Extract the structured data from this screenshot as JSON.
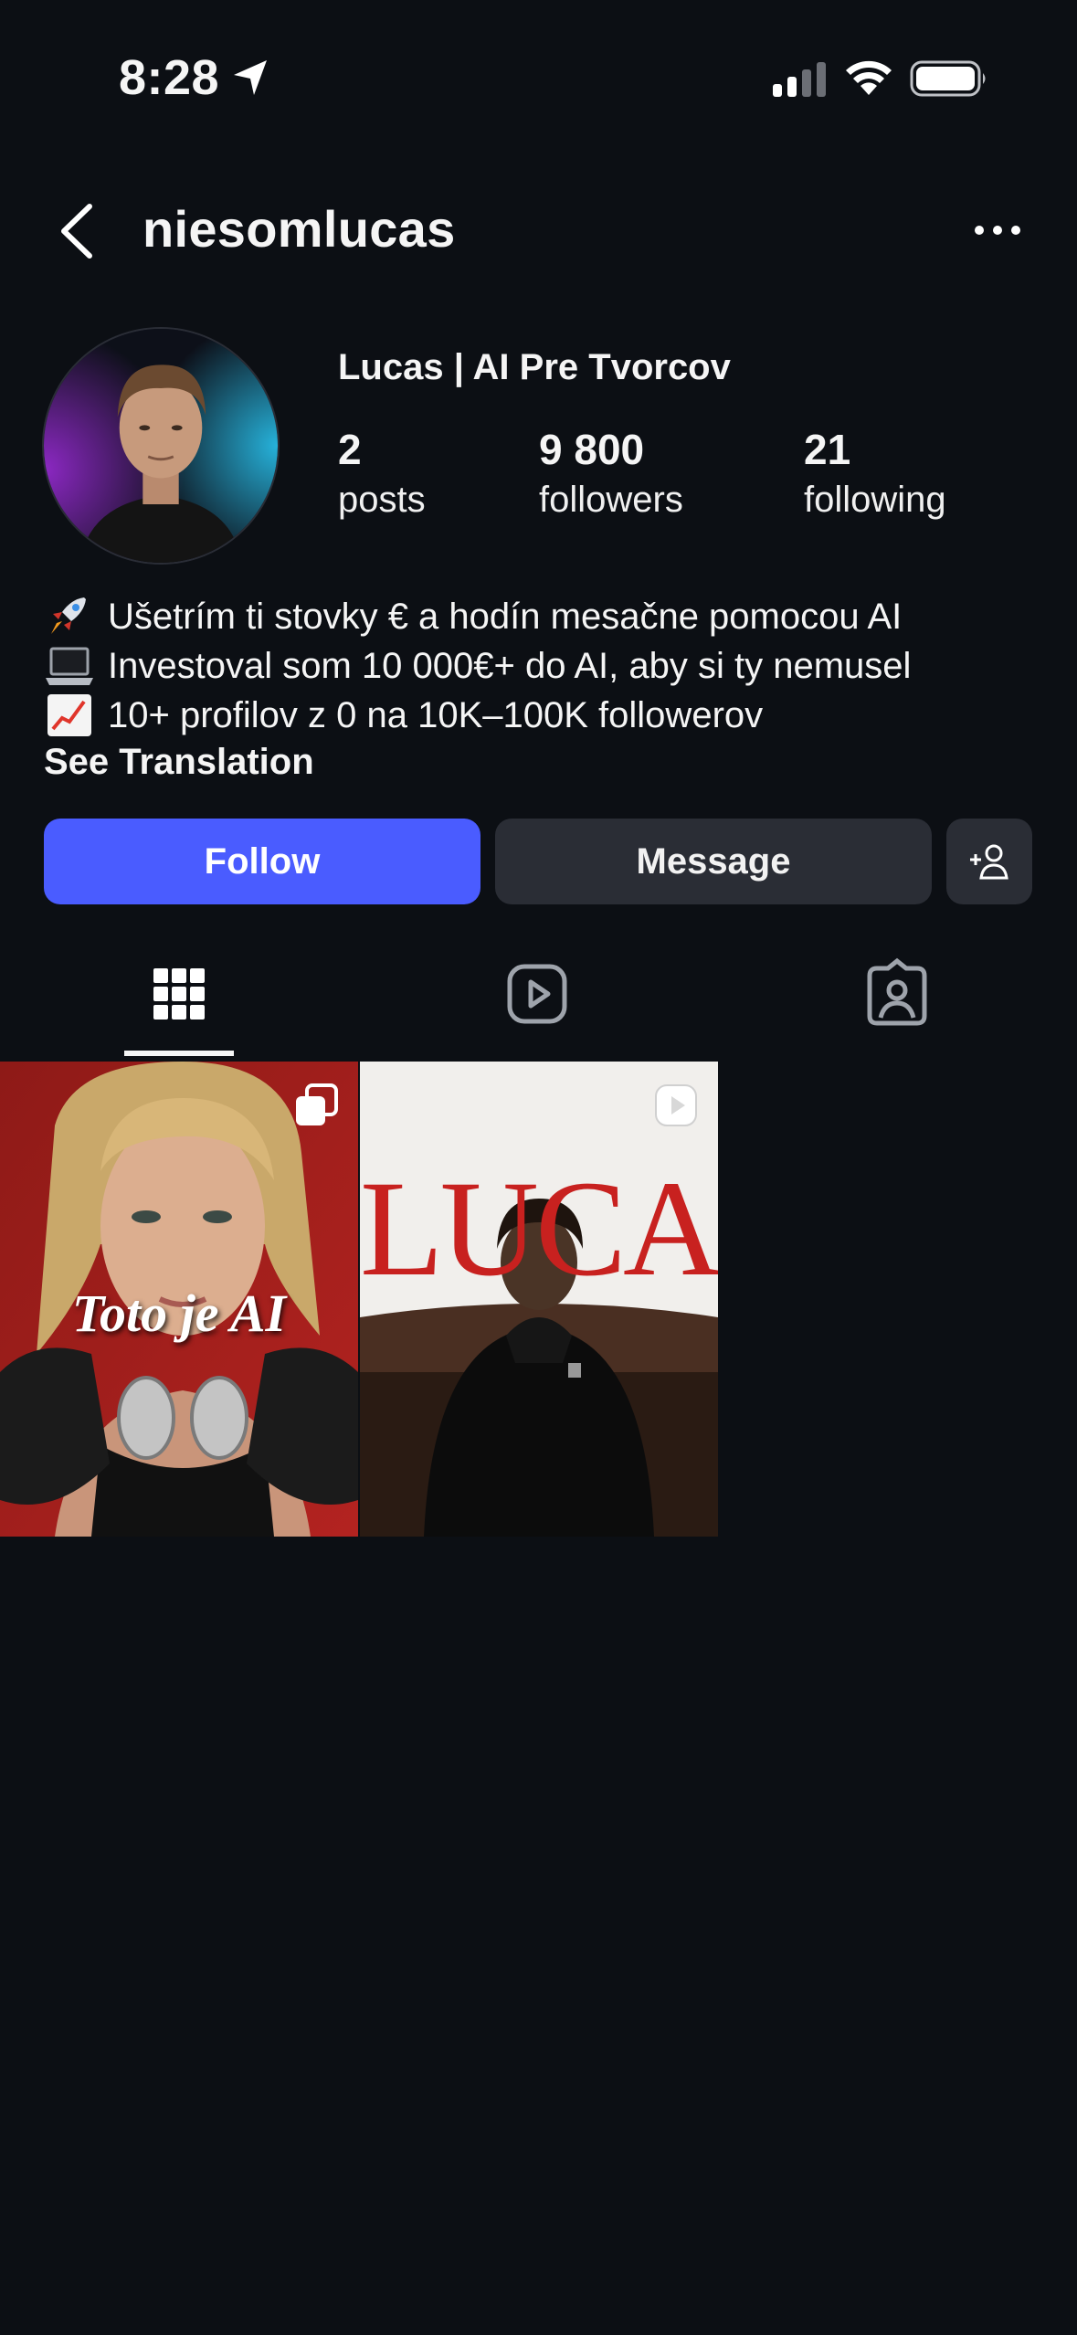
{
  "status_bar": {
    "time": "8:28",
    "icons": [
      "location-arrow-icon",
      "cellular-signal-icon",
      "wifi-icon",
      "battery-icon"
    ]
  },
  "header": {
    "username": "niesomlucas",
    "back_icon": "chevron-left-icon",
    "more_icon": "more-horizontal-icon"
  },
  "profile": {
    "display_name": "Lucas | AI Pre Tvorcov",
    "stats": {
      "posts": {
        "value": "2",
        "label": "posts"
      },
      "followers": {
        "value": "9 800",
        "label": "followers"
      },
      "following": {
        "value": "21",
        "label": "following"
      }
    },
    "bio": [
      {
        "emoji": "rocket-icon",
        "text": "Ušetrím ti stovky € a hodín mesačne pomocou AI"
      },
      {
        "emoji": "laptop-icon",
        "text": "Investoval som 10 000€+ do AI, aby si ty nemusel"
      },
      {
        "emoji": "chart-increasing-icon",
        "text": "10+ profilov z 0 na 10K–100K followerov"
      }
    ],
    "see_translation": "See Translation"
  },
  "actions": {
    "follow_label": "Follow",
    "message_label": "Message",
    "add_person_icon": "add-person-icon"
  },
  "tabs": [
    {
      "name": "grid",
      "icon": "grid-icon",
      "active": true
    },
    {
      "name": "reels",
      "icon": "reels-icon",
      "active": false
    },
    {
      "name": "tagged",
      "icon": "tagged-icon",
      "active": false
    }
  ],
  "posts": [
    {
      "overlay_text": "Toto je AI",
      "badge": "carousel-icon"
    },
    {
      "overlay_text": "LUCAS",
      "badge": "reel-icon"
    }
  ],
  "colors": {
    "background": "#0c0f14",
    "follow_button": "#4a5cff",
    "secondary_button": "#2a2d35"
  }
}
